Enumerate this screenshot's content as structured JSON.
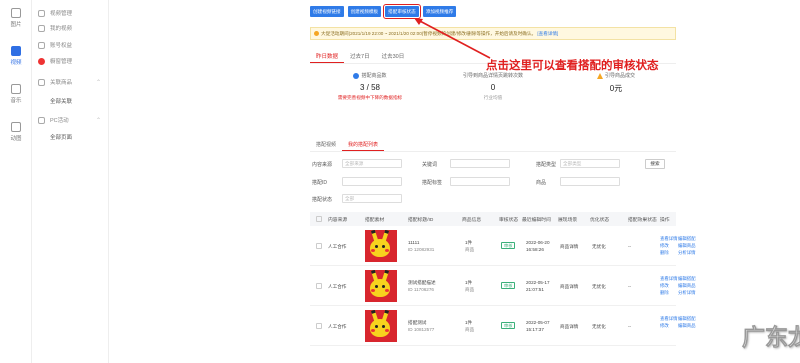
{
  "rail": [
    {
      "label": "图片",
      "icon": "image-icon"
    },
    {
      "label": "视频",
      "icon": "video-icon",
      "active": true
    },
    {
      "label": "音乐",
      "icon": "music-icon"
    },
    {
      "label": "动图",
      "icon": "gif-icon"
    }
  ],
  "subnav": {
    "items": [
      "视频管理",
      "我的视频",
      "账号权益",
      "橱窗管理"
    ],
    "groups": [
      {
        "label": "关联商品",
        "sub": "全部关联"
      },
      {
        "label": "PC活动",
        "sub": "全部页面"
      }
    ]
  },
  "top_buttons": [
    "创建视频链接",
    "创建视频模板",
    "搭配审核状态",
    "添加视频推荐"
  ],
  "notice": {
    "text": "大促活动期间(2021/1/19 22:00 ~ 2021/1/20 02:00)暂停视频的创建/修改/删除等操作，开始后请及时确认。",
    "link": "[查看详情]"
  },
  "date_tabs": [
    "昨日数据",
    "过去7日",
    "过去30日"
  ],
  "stats": [
    {
      "label": "搭配商品数",
      "value": "3 / 58",
      "sub": "需要完善视频中下降的数据指标"
    },
    {
      "label": "引导到商品详情页跳转次数",
      "value": "0",
      "sub": "行业均值"
    },
    {
      "label": "引导商品成交",
      "value": "0元",
      "sub": ""
    }
  ],
  "annotation": "点击这里可以查看搭配的审核状态",
  "list_tabs": [
    "搭配视频",
    "我的搭配列表"
  ],
  "filters": {
    "content_source_label": "内容来源",
    "content_source_ph": "全部来源",
    "title_label": "关键词",
    "title_ph": "",
    "type_label": "搭配类型",
    "type_ph": "全部类型",
    "id_label": "搭配ID",
    "tag_label": "搭配标签",
    "item_label": "商品",
    "status_label": "搭配状态",
    "status_ph": "全部",
    "search": "搜索"
  },
  "table": {
    "headers": [
      "内容来源",
      "搭配素材",
      "搭配标题/ID",
      "商品信息",
      "审核状态",
      "最近编辑时间",
      "展现场景",
      "优化状态",
      "搭配效果状态",
      "操作"
    ],
    "rows": [
      {
        "source": "人工合作",
        "title": "11111",
        "id": "ID 12082931",
        "item": "1件",
        "item2": "商品",
        "status": "审核",
        "time": "2022-06-20",
        "time2": "16:58:26",
        "scene": "商品详情",
        "opt": "无优化",
        "effect": "--",
        "ops": [
          "查看详情",
          "修改",
          "删除"
        ],
        "ops2": [
          "编辑搭配",
          "编辑商品",
          "分析详情"
        ]
      },
      {
        "source": "人工合作",
        "title": "测试搭配描述",
        "id": "ID 11706276",
        "item": "1件",
        "item2": "商品",
        "status": "审核",
        "time": "2022-05-17",
        "time2": "21:07:51",
        "scene": "商品详情",
        "opt": "无优化",
        "effect": "--",
        "ops": [
          "查看详情",
          "修改",
          "删除"
        ],
        "ops2": [
          "编辑搭配",
          "编辑商品",
          "分析详情"
        ]
      },
      {
        "source": "人工合作",
        "title": "搭配测试",
        "id": "ID 10812577",
        "item": "1件",
        "item2": "商品",
        "status": "审核",
        "time": "2022-05-07",
        "time2": "15:17:37",
        "scene": "商品详情",
        "opt": "无优化",
        "effect": "--",
        "ops": [
          "查看详情",
          "修改"
        ],
        "ops2": [
          "编辑搭配",
          "编辑商品"
        ]
      }
    ]
  },
  "watermark": "广东龙网"
}
